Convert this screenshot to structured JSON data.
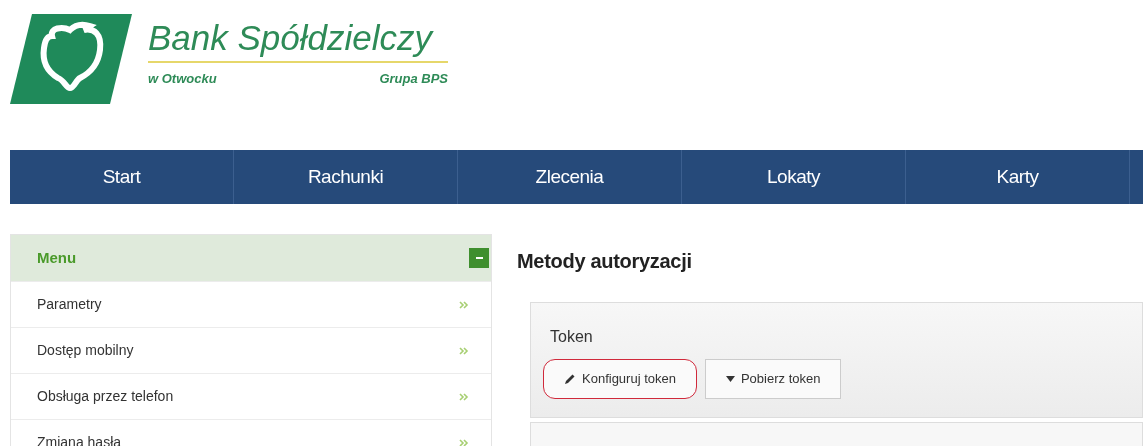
{
  "logo": {
    "name": "Bank Spółdzielczy",
    "branch": "w Otwocku",
    "group": "Grupa BPS"
  },
  "nav": [
    {
      "label": "Start",
      "selected": false
    },
    {
      "label": "Rachunki",
      "selected": false
    },
    {
      "label": "Zlecenia",
      "selected": false
    },
    {
      "label": "Lokaty",
      "selected": false
    },
    {
      "label": "Karty",
      "selected": false
    }
  ],
  "sidebar": {
    "title": "Menu",
    "expanded": true,
    "items": [
      {
        "label": "Parametry"
      },
      {
        "label": "Dostęp mobilny"
      },
      {
        "label": "Obsługa przez telefon"
      },
      {
        "label": "Zmiana hasła"
      }
    ]
  },
  "main": {
    "title": "Metody autoryzacji",
    "panels": [
      {
        "title": "Token",
        "buttons": [
          {
            "label": "Konfiguruj token",
            "kind": "edit",
            "highlighted": true
          },
          {
            "label": "Pobierz token",
            "kind": "dropdown",
            "highlighted": false
          }
        ]
      }
    ]
  }
}
